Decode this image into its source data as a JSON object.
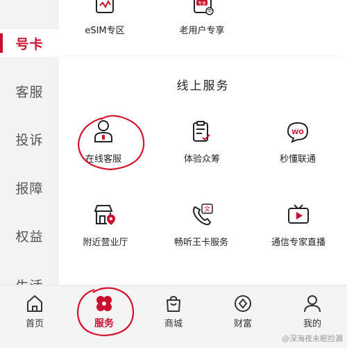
{
  "sidebar": {
    "items": [
      {
        "label": "号卡",
        "active": true
      },
      {
        "label": "客服",
        "active": false
      },
      {
        "label": "投诉",
        "active": false
      },
      {
        "label": "报障",
        "active": false
      },
      {
        "label": "权益",
        "active": false
      },
      {
        "label": "生活",
        "active": false
      }
    ]
  },
  "top_services": [
    {
      "label": "eSIM专区",
      "icon": "esim-card-icon"
    },
    {
      "label": "老用户专享",
      "icon": "exclusive-offer-icon",
      "badge": "专享"
    }
  ],
  "online_services": {
    "title": "线上服务",
    "items": [
      {
        "label": "在线客服",
        "icon": "customer-service-icon"
      },
      {
        "label": "体验众筹",
        "icon": "clipboard-check-icon"
      },
      {
        "label": "秒懂联通",
        "icon": "chat-bubble-icon",
        "badge": "WO"
      },
      {
        "label": "附近营业厅",
        "icon": "store-location-icon"
      },
      {
        "label": "畅听王卡服务",
        "icon": "phone-service-icon",
        "badge": "文"
      },
      {
        "label": "通信专家直播",
        "icon": "live-tv-icon"
      }
    ]
  },
  "bottom_nav": [
    {
      "label": "首页",
      "icon": "home-icon",
      "active": false
    },
    {
      "label": "服务",
      "icon": "service-petal-icon",
      "active": true
    },
    {
      "label": "商城",
      "icon": "shopping-bag-icon",
      "active": false
    },
    {
      "label": "财富",
      "icon": "wealth-coin-icon",
      "active": false
    },
    {
      "label": "我的",
      "icon": "profile-icon",
      "active": false
    }
  ],
  "watermark": "@深海夜未眠捡漏",
  "colors": {
    "accent": "#c8102e",
    "annotation": "#d4142d",
    "sidebar_bg": "#f3f3f3"
  }
}
